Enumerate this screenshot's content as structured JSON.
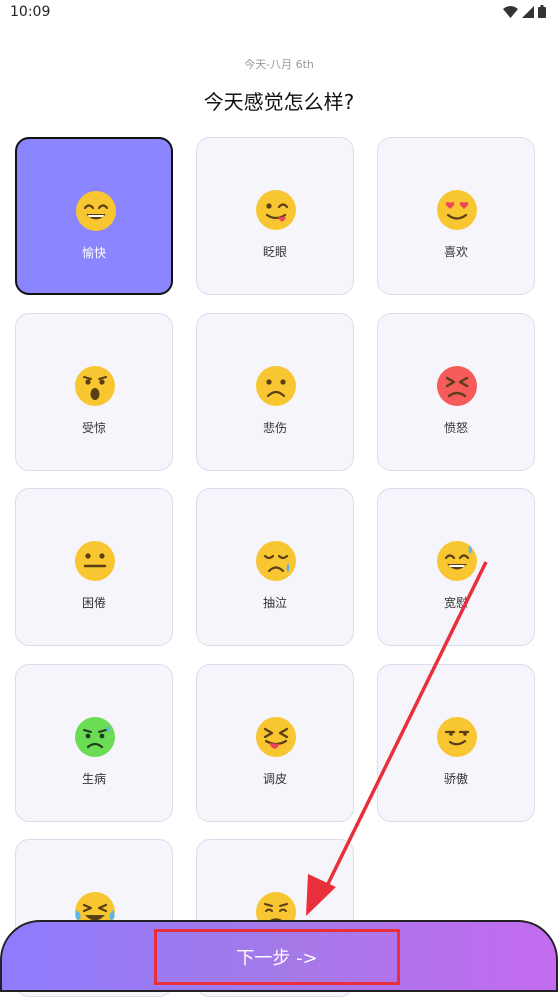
{
  "status_bar": {
    "time": "10:09"
  },
  "header": {
    "date": "今天-八月 6th",
    "question": "今天感觉怎么样?"
  },
  "moods": [
    {
      "label": "愉快",
      "color": "#f7c630",
      "icon": "grinning-face",
      "selected": true
    },
    {
      "label": "眨眼",
      "color": "#f7c630",
      "icon": "winking-tongue-face"
    },
    {
      "label": "喜欢",
      "color": "#f7c630",
      "icon": "heart-eyes-face"
    },
    {
      "label": "受惊",
      "color": "#f7c630",
      "icon": "shocked-face"
    },
    {
      "label": "悲伤",
      "color": "#f7c630",
      "icon": "sad-face"
    },
    {
      "label": "愤怒",
      "color": "#f55b5b",
      "icon": "angry-face"
    },
    {
      "label": "困倦",
      "color": "#f7c630",
      "icon": "neutral-face"
    },
    {
      "label": "抽泣",
      "color": "#f7c630",
      "icon": "sobbing-face"
    },
    {
      "label": "宽慰",
      "color": "#f7c630",
      "icon": "relieved-sweat-face"
    },
    {
      "label": "生病",
      "color": "#6ddc55",
      "icon": "sick-face"
    },
    {
      "label": "调皮",
      "color": "#f7c630",
      "icon": "squinting-tongue-face"
    },
    {
      "label": "骄傲",
      "color": "#f7c630",
      "icon": "smirking-face"
    },
    {
      "label": "",
      "color": "#f7c630",
      "icon": "crying-laughing-face"
    },
    {
      "label": "",
      "color": "#f7c630",
      "icon": "worried-face"
    }
  ],
  "next_button": {
    "label": "下一步 ->"
  },
  "annotation": {
    "color": "#ea2f3c"
  }
}
